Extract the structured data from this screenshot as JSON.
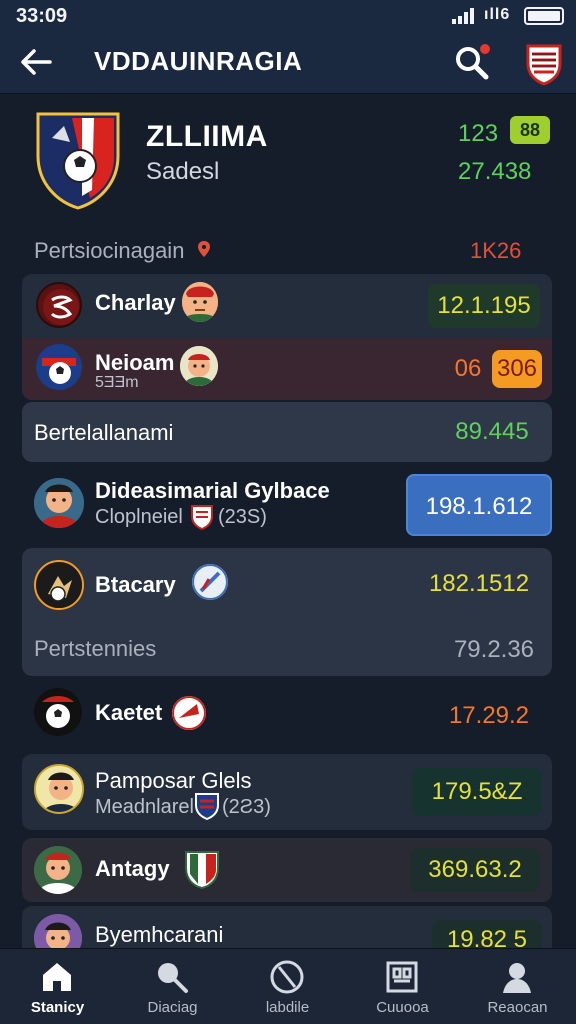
{
  "status_bar": {
    "time": "33:09",
    "wifi_label": "ıll6"
  },
  "app_bar": {
    "title": "VDDAUINRAGIA"
  },
  "hero": {
    "club_name": "ZLLIIMA",
    "club_sub": "Sadesl",
    "stat_top": "123",
    "stat_badge": "88",
    "stat_bottom": "27.438"
  },
  "section": {
    "label": "Pertsiocinagain",
    "value": "1K26"
  },
  "rows": [
    {
      "title": "Charlay",
      "score": "12.1.195"
    },
    {
      "title": "Neioam",
      "sub": "5ƎƎm",
      "score_a": "06",
      "score_b": "306"
    },
    {
      "title": "Bertelallanami",
      "score": "89.445"
    },
    {
      "title": "Dideasimarial Gylbace",
      "sub": "Cloplneiel",
      "sub_extra": "(23S)",
      "score": "198.1.612"
    },
    {
      "title": "Btacary",
      "sub": "Pertstennies",
      "score": "182.1512",
      "score_b": "79.2.36"
    },
    {
      "title": "Kaetet",
      "score": "17.29.2"
    },
    {
      "title": "Pamposar Glels",
      "sub": "Meadnlarel",
      "sub_extra": "(2Ƨ3)",
      "score": "179.5&Z"
    },
    {
      "title": "Antagy",
      "score": "369.63.2"
    },
    {
      "title": "Byemhcarani",
      "score": "19.82 5"
    }
  ],
  "nav": [
    {
      "label": "Stanicy",
      "icon": "home-icon"
    },
    {
      "label": "Diaciag",
      "icon": "whistle-icon"
    },
    {
      "label": "labdile",
      "icon": "clock-icon"
    },
    {
      "label": "Cuuooa",
      "icon": "stadium-icon"
    },
    {
      "label": "Reaocan",
      "icon": "profile-icon"
    }
  ],
  "colors": {
    "background": "#151d2b",
    "appbar": "#1b2940",
    "green": "#5dd25b",
    "red": "#e0513a",
    "orange": "#f59a22",
    "blue_box": "#3a6fbf"
  }
}
